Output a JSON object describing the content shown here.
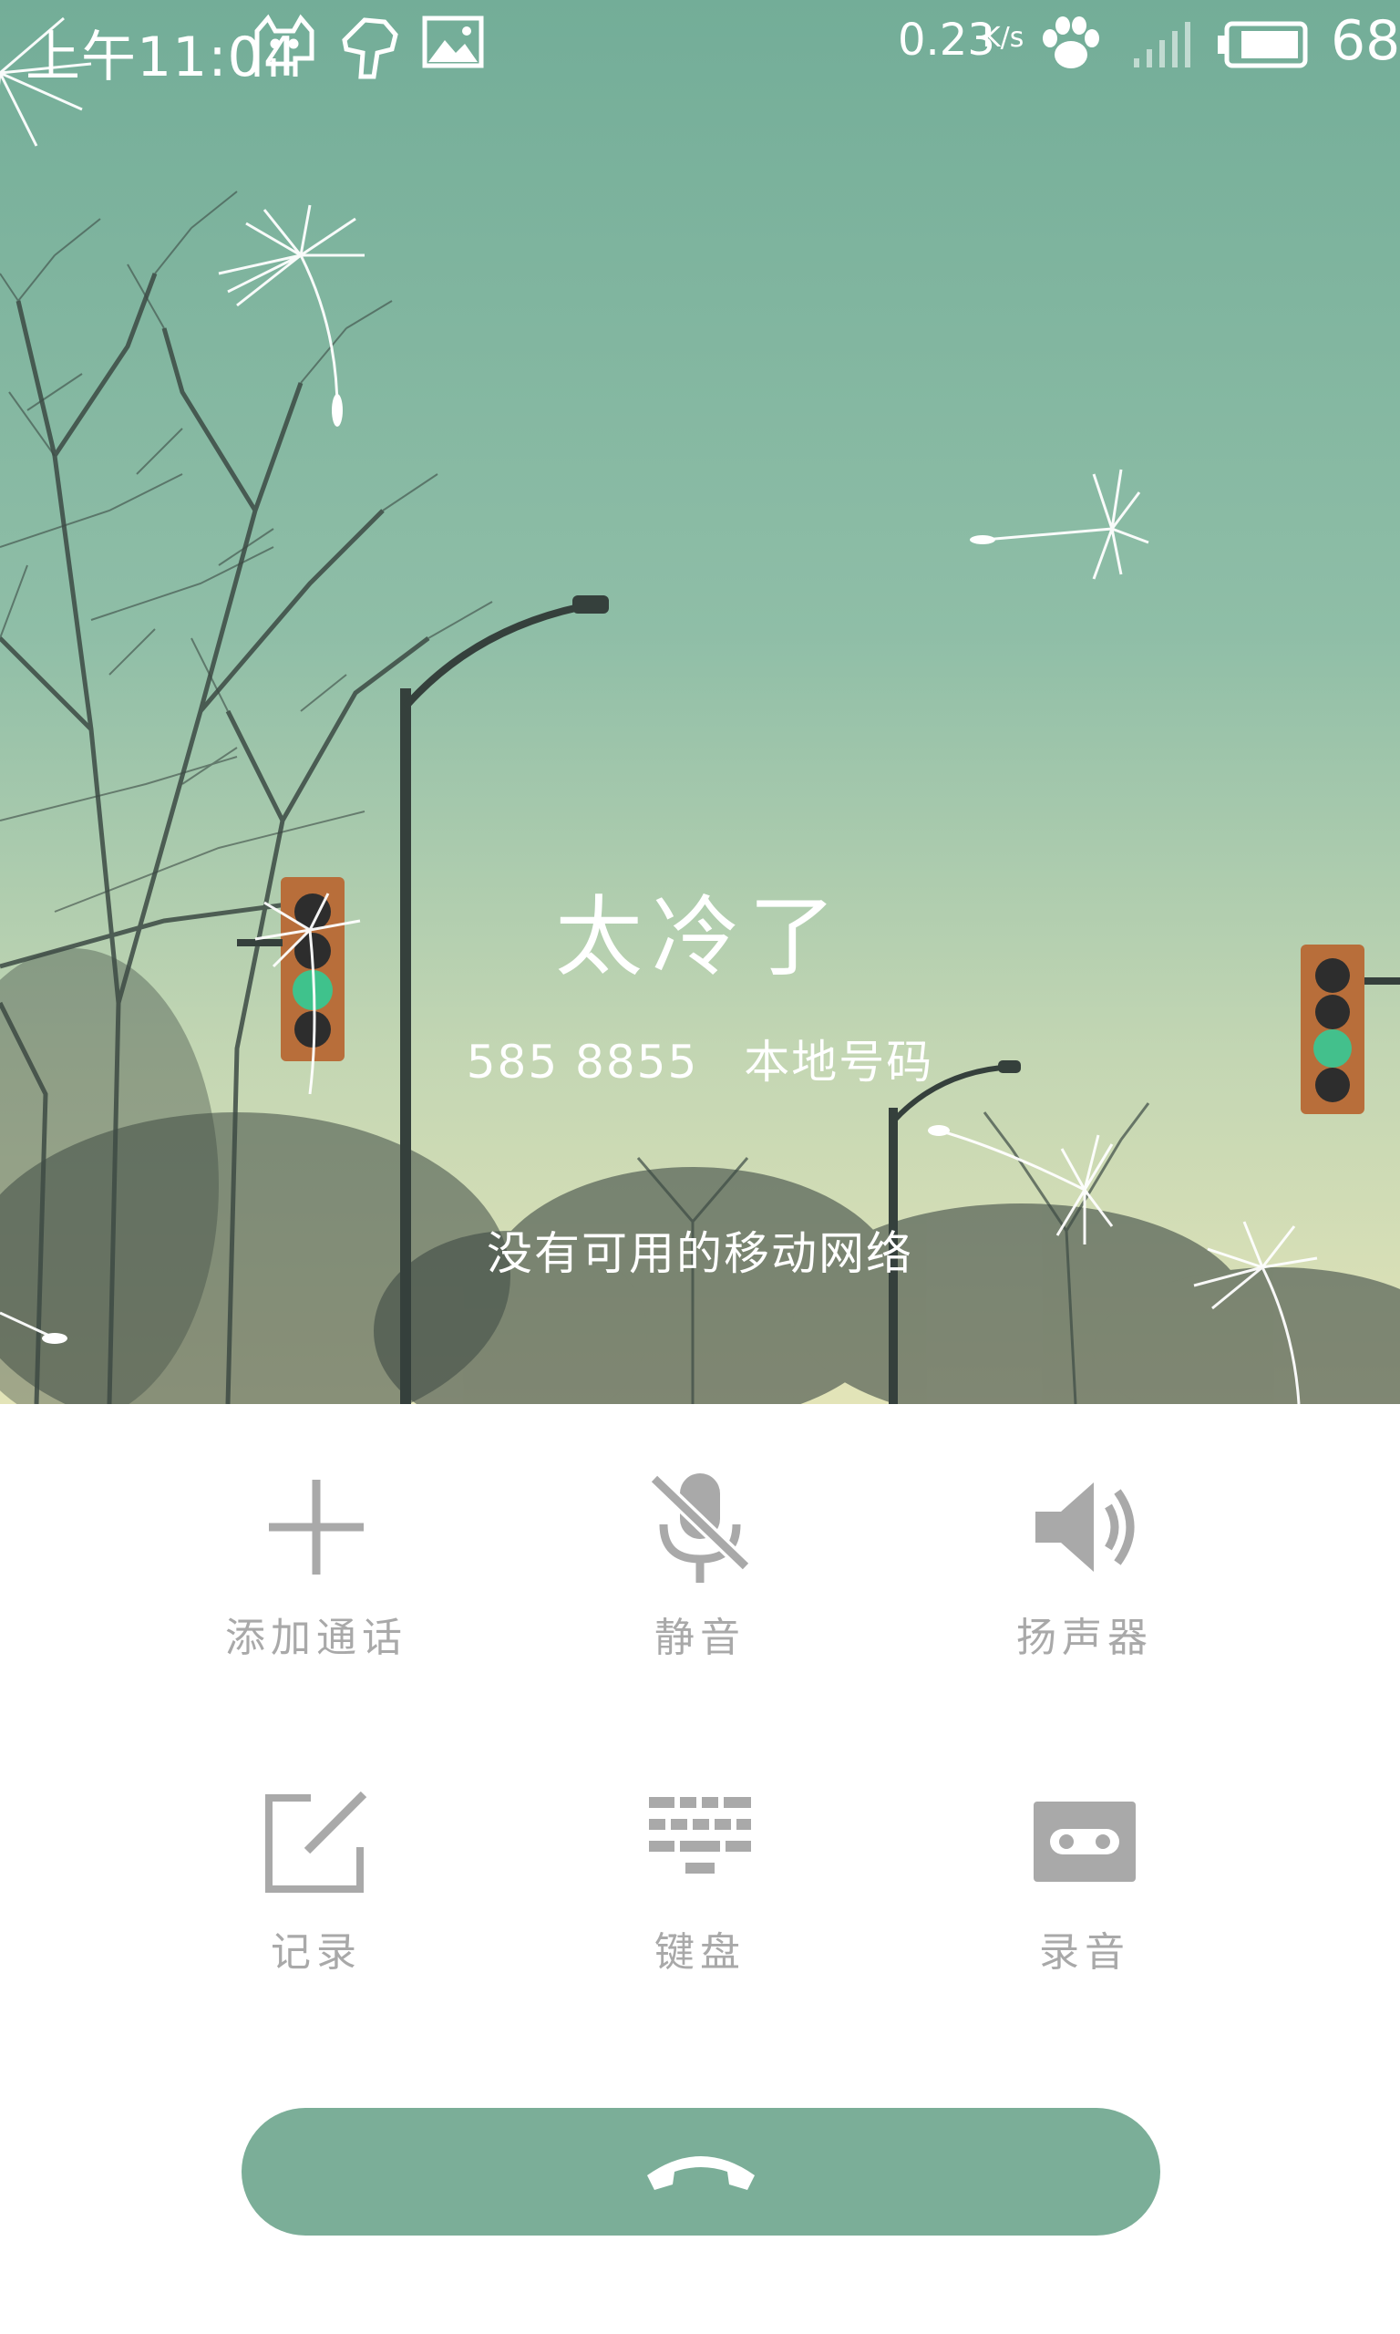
{
  "status_bar": {
    "time": "上午11:04",
    "net_speed_value": "0.23",
    "net_speed_unit": "K/s",
    "battery_level": "68",
    "icons": [
      "cat-icon",
      "hand-icon",
      "image-icon",
      "paw-icon",
      "signal-icon",
      "battery-icon"
    ]
  },
  "call": {
    "name": "太冷了",
    "number": "585 8855",
    "location": "本地号码",
    "status": "没有可用的移动网络"
  },
  "controls": {
    "add_call": "添加通话",
    "mute": "静音",
    "speaker": "扬声器",
    "notes": "记录",
    "keypad": "键盘",
    "record": "录音"
  },
  "colors": {
    "sky_top": "#78b09c",
    "sky_bottom": "#dfe2b8",
    "accent": "#7bae98",
    "icon_gray": "#a9a9a9"
  }
}
